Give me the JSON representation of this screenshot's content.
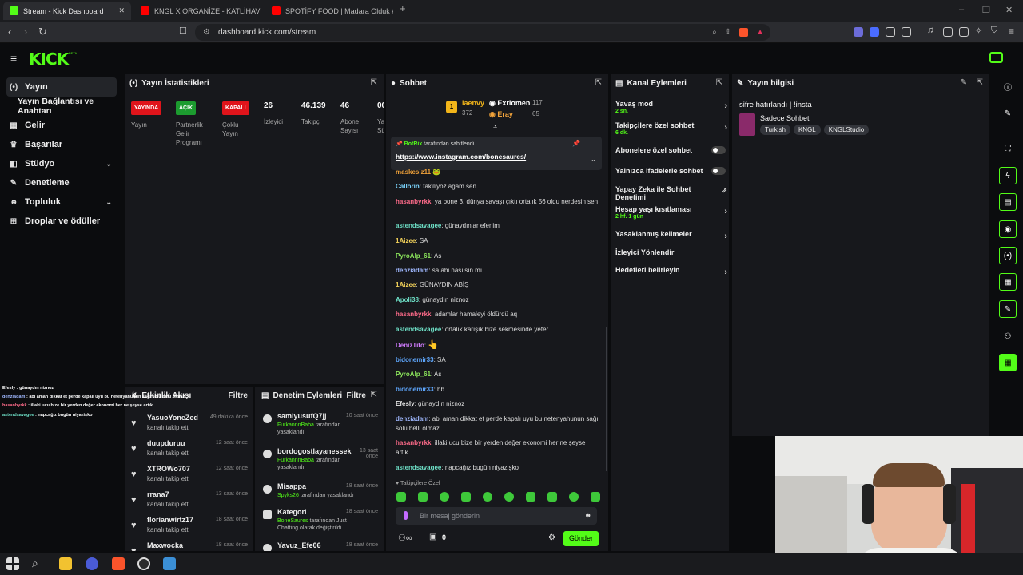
{
  "browser": {
    "tabs": [
      {
        "title": "Stream - Kick Dashboard",
        "favicon_color": "#53fc18"
      },
      {
        "title": "KNGL X ORGANİZE - KATLİHAV 4",
        "favicon_color": "#ff0000"
      },
      {
        "title": "SPOTİFY FOOD | Madara Olduk #658",
        "favicon_color": "#ff0000"
      }
    ],
    "new_tab": "+",
    "url": "dashboard.kick.com/stream",
    "controls": {
      "minimize": "–",
      "restore": "❐",
      "close": "✕"
    }
  },
  "header": {
    "logo": "KICK",
    "beta": "BETA"
  },
  "sidebar": {
    "items": [
      {
        "label": "Yayın",
        "icon": "broadcast-icon"
      },
      {
        "label": "Yayın Bağlantısı ve Anahtarı",
        "icon": ""
      },
      {
        "label": "Gelir",
        "icon": "revenue-icon"
      },
      {
        "label": "Başarılar",
        "icon": "trophy-icon"
      },
      {
        "label": "Stüdyo",
        "icon": "studio-icon"
      },
      {
        "label": "Denetleme",
        "icon": "wrench-icon"
      },
      {
        "label": "Topluluk",
        "icon": "community-icon"
      },
      {
        "label": "Droplar ve ödüller",
        "icon": "gift-icon"
      }
    ]
  },
  "stats": {
    "title": "Yayın İstatistikleri",
    "badges": [
      {
        "badge": "YAYINDA",
        "label": "Yayın",
        "color": "#e0141b"
      },
      {
        "badge": "AÇIK",
        "label": "Partnerlik Gelir Programı",
        "color": "#1c9b2f"
      },
      {
        "badge": "KAPALI",
        "label": "Çoklu Yayın",
        "color": "#e0141b"
      }
    ],
    "numbers": [
      {
        "value": "26",
        "label": "İzleyici"
      },
      {
        "value": "46.139",
        "label": "Takipçi"
      },
      {
        "value": "46",
        "label": "Abone Sayısı"
      },
      {
        "value": "00",
        "label": "Ya Sü"
      }
    ]
  },
  "activity": {
    "title": "Etkinlik Akışı",
    "filter": "Filtre",
    "items": [
      {
        "name": "YasuoYoneZed",
        "sub": "kanalı takip etti",
        "time": "49 dakika önce"
      },
      {
        "name": "duupduruu",
        "sub": "kanalı takip etti",
        "time": "12 saat önce"
      },
      {
        "name": "XTROWo707",
        "sub": "kanalı takip etti",
        "time": "12 saat önce"
      },
      {
        "name": "rrana7",
        "sub": "kanalı takip etti",
        "time": "13 saat önce"
      },
      {
        "name": "florianwirtz17",
        "sub": "kanalı takip etti",
        "time": "18 saat önce"
      },
      {
        "name": "Maxwocka",
        "sub": "",
        "time": "18 saat önce"
      }
    ]
  },
  "moderation": {
    "title": "Denetim Eylemleri",
    "filter": "Filtre",
    "items": [
      {
        "name": "samiyusufQ7jj",
        "actor": "FurkannnBaba",
        "sub": " tarafından yasaklandı",
        "time": "10 saat önce"
      },
      {
        "name": "bordogostlayanessek",
        "actor": "FurkannnBaba",
        "sub": " tarafından yasaklandı",
        "time": "13 saat önce"
      },
      {
        "name": "Misappa",
        "actor": "Spyks26",
        "sub": " tarafından yasaklandı",
        "time": "18 saat önce"
      },
      {
        "name": "Kategori",
        "actor": "BoneSaures",
        "sub": " tarafından Just Chatting olarak değiştirildi",
        "time": "18 saat önce"
      },
      {
        "name": "Yavuz_Efe06",
        "actor": "",
        "sub": "",
        "time": "18 saat önce"
      }
    ]
  },
  "chat": {
    "title": "Sohbet",
    "leaderboard": [
      {
        "rank": "1",
        "name": "iaenvy",
        "points": "372"
      },
      {
        "name": "Exriomen",
        "points": "117"
      },
      {
        "name": "Eray",
        "points": "65"
      }
    ],
    "pinned": {
      "by": "BotRix",
      "suffix": " tarafından sabitlendi",
      "link": "https://www.instagram.com/bonesaures/"
    },
    "messages": [
      {
        "user": "maskesiz11",
        "color": "#f2a33a",
        "text": ""
      },
      {
        "user": "Callorin",
        "color": "#7cd6ff",
        "text": "takılıyoz agam sen"
      },
      {
        "user": "hasanbyrkk",
        "color": "#ff6b8a",
        "text": "ya bone 3. dünya savaşı çıktı ortalık 56 oldu nerdesin sen"
      },
      {
        "user": "astendsavagee",
        "color": "#6ee0c7",
        "text": "günaydınlar efenim"
      },
      {
        "user": "1Aizee",
        "color": "#f2d15a",
        "text": "SA"
      },
      {
        "user": "PyroAlp_61",
        "color": "#8ce65c",
        "text": "As"
      },
      {
        "user": "denziadam",
        "color": "#9fb8ff",
        "text": "sa abi nasılsın mı"
      },
      {
        "user": "1Aizee",
        "color": "#f2d15a",
        "text": "GÜNAYDIN ABİŞ"
      },
      {
        "user": "Apoli38",
        "color": "#6ee0c7",
        "text": "günaydın niznoz"
      },
      {
        "user": "hasanbyrkk",
        "color": "#ff6b8a",
        "text": "adamlar hamaleyi öldürdü aq"
      },
      {
        "user": "astendsavagee",
        "color": "#6ee0c7",
        "text": "ortalık karışık bize sekmesinde yeter"
      },
      {
        "user": "DenizTito",
        "color": "#d17cff",
        "text": "👆"
      },
      {
        "user": "bidonemir33",
        "color": "#5fa8ff",
        "text": "SA"
      },
      {
        "user": "PyroAlp_61",
        "color": "#8ce65c",
        "text": "As"
      },
      {
        "user": "bidonemir33",
        "color": "#5fa8ff",
        "text": "hb"
      },
      {
        "user": "Efesly",
        "color": "#e8e8e8",
        "text": "günaydın niznoz"
      },
      {
        "user": "denziadam",
        "color": "#9fb8ff",
        "text": "abi aman dikkat et perde kapalı uyu bu netenyahunun sağı solu belli olmaz"
      },
      {
        "user": "hasanbyrkk",
        "color": "#ff6b8a",
        "text": "illaki ucu bize bir yerden değer ekonomi her ne şeyse artık"
      },
      {
        "user": "astendsavagee",
        "color": "#6ee0c7",
        "text": "napcağız bugün niyazişko"
      }
    ],
    "followers_only": "Takipçilere Özel",
    "placeholder": "Bir mesaj gönderin",
    "send": "Gönder",
    "count": "0"
  },
  "channel_actions": {
    "title": "Kanal Eylemleri",
    "items": [
      {
        "label": "Yavaş mod",
        "sub": "2 sn.",
        "kind": "arrow"
      },
      {
        "label": "Takipçilere özel sohbet",
        "sub": "6 dk.",
        "kind": "arrow"
      },
      {
        "label": "Abonelere özel sohbet",
        "sub": "",
        "kind": "toggle"
      },
      {
        "label": "Yalnızca ifadelerle sohbet",
        "sub": "",
        "kind": "toggle"
      },
      {
        "label": "Yapay Zeka ile Sohbet Denetimi",
        "sub": "",
        "kind": "ext"
      },
      {
        "label": "Hesap yaşı kısıtlaması",
        "sub": "2 hf. 1 gün",
        "kind": "arrow"
      },
      {
        "label": "Yasaklanmış kelimeler",
        "sub": "",
        "kind": "arrow"
      },
      {
        "label": "İzleyici Yönlendir",
        "sub": "",
        "kind": "none"
      },
      {
        "label": "Hedefleri belirleyin",
        "sub": "",
        "kind": "arrow"
      }
    ]
  },
  "stream_info": {
    "title": "Yayın bilgisi",
    "stream_title": "sifre hatırlandı | !insta",
    "category": "Sadece Sohbet",
    "tags": [
      "Turkish",
      "KNGL",
      "KNGLStudio"
    ]
  },
  "overlay_chat": [
    {
      "user": "Efesly",
      "text": "günaydın niznoz",
      "color": "#ffffff"
    },
    {
      "user": "denziadam",
      "text": "abi aman dikkat et perde kapalı uyu bu netenyahunun sağı solu belli olmaz",
      "color": "#9fb8ff"
    },
    {
      "user": "hasanbyrkk",
      "text": "illaki ucu bize bir yerden değer ekonomi her ne şeyse artık",
      "color": "#ff6b8a"
    },
    {
      "user": "astendsavagee",
      "text": "napcağız bugün niyazişko",
      "color": "#6ee0c7"
    }
  ]
}
